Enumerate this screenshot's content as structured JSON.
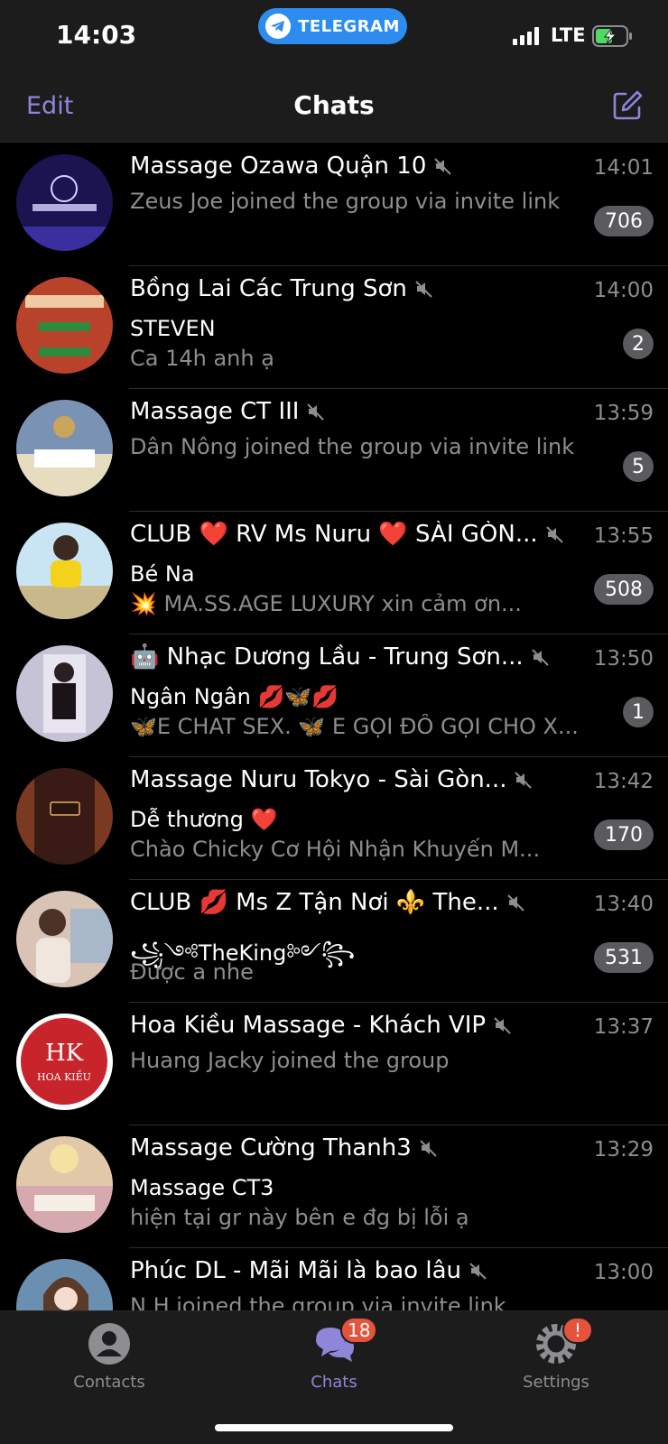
{
  "status_bar": {
    "time": "14:03",
    "app_pill": "TELEGRAM",
    "network": "LTE"
  },
  "nav": {
    "edit": "Edit",
    "title": "Chats"
  },
  "chats": [
    {
      "title": "Massage Ozawa Quận 10",
      "time": "14:01",
      "sender": "",
      "message": "Zeus Joe joined the group via invite link",
      "unread": "706",
      "avatar_color": "#1a1450"
    },
    {
      "title": "Bồng Lai Các Trung Sơn",
      "time": "14:00",
      "sender": "STEVEN",
      "message": "Ca 14h anh ạ",
      "unread": "2",
      "avatar_color": "#b8432a"
    },
    {
      "title": "Massage CT III",
      "time": "13:59",
      "sender": "",
      "message": "Dân Nông joined the group via invite link",
      "unread": "5",
      "avatar_color": "#7a93b5"
    },
    {
      "title": "CLUB ❤️ RV Ms Nuru ❤️ SÀI GÒN...",
      "time": "13:55",
      "sender": "Bé Na",
      "message": "💥 MA.SS.AGE LUXURY xin cảm ơn...",
      "unread": "508",
      "avatar_color": "#c9b98a"
    },
    {
      "title": "🤖 Nhạc Dương Lầu - Trung Sơn...",
      "time": "13:50",
      "sender": "Ngân Ngân 💋🦋💋",
      "message": "🦋E CHAT SEX. 🦋 E GỌI ĐỒ GỌI CHO X...",
      "unread": "1",
      "avatar_color": "#c7c3d6"
    },
    {
      "title": "Massage Nuru Tokyo - Sài Gòn...",
      "time": "13:42",
      "sender": "Dễ thương ❤️",
      "message": "Chào Chicky Cơ Hội Nhận Khuyến M...",
      "unread": "170",
      "avatar_color": "#3a1a14"
    },
    {
      "title": "CLUB 💋 Ms Z Tận Nơi ⚜️ The...",
      "time": "13:40",
      "sender": "꧁༺TheKing༻꧂",
      "message": "Được a nhe",
      "unread": "531",
      "avatar_color": "#d8c3b5"
    },
    {
      "title": "Hoa Kiều Massage - Khách VIP",
      "time": "13:37",
      "sender": "",
      "message": "Huang Jacky joined the group",
      "unread": "",
      "avatar_color": "#c8242b"
    },
    {
      "title": "Massage Cường Thanh3",
      "time": "13:29",
      "sender": "Massage CT3",
      "message": "hiện tại gr này bên e đg bị lỗi ạ",
      "unread": "",
      "avatar_color": "#e0c8a8"
    },
    {
      "title": "Phúc DL - Mãi Mãi là bao lâu",
      "time": "13:00",
      "sender": "",
      "message": "N.H joined the group via invite link",
      "unread": "",
      "avatar_color": "#6a8fb0"
    }
  ],
  "tabs": [
    {
      "label": "Contacts",
      "badge": ""
    },
    {
      "label": "Chats",
      "badge": "18"
    },
    {
      "label": "Settings",
      "badge": "!"
    }
  ],
  "colors": {
    "accent": "#8e86d9",
    "badge_bg": "#5b5b5f",
    "tab_badge": "#e5533c",
    "telegram_blue": "#2d8cf0"
  }
}
